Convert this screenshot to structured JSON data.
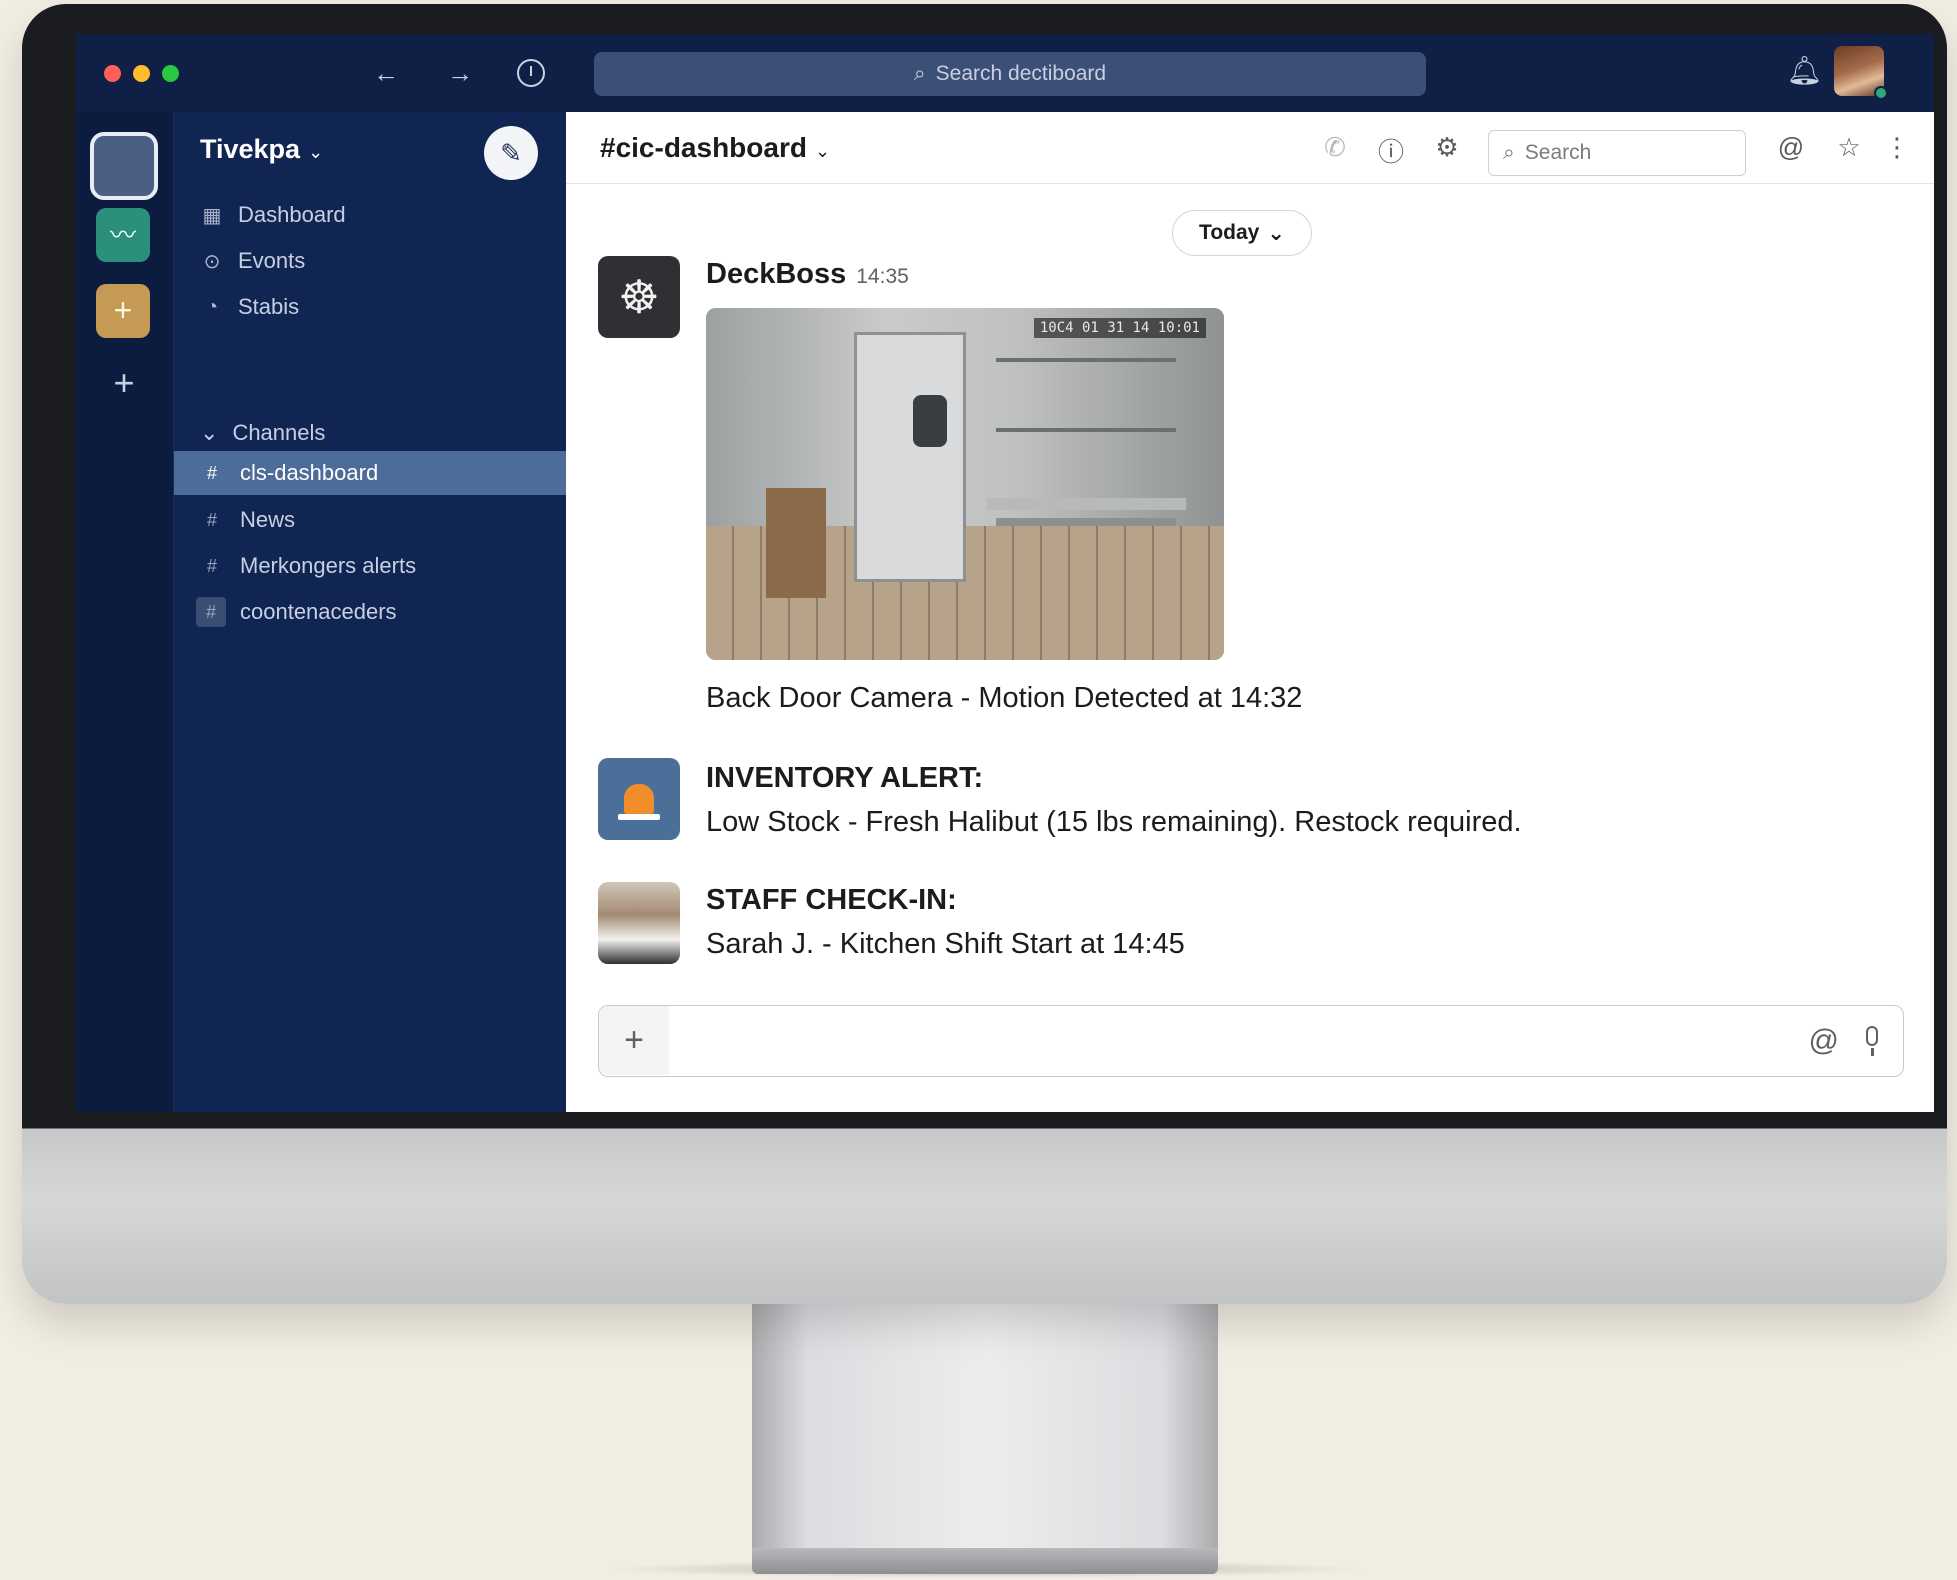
{
  "titlebar": {
    "search_placeholder": "Search dectiboard",
    "icons": [
      "back-arrow-icon",
      "forward-arrow-icon",
      "history-icon",
      "bell-icon"
    ]
  },
  "rail": {
    "workspaces": [
      "active-workspace",
      "chart-workspace",
      "plus-workspace"
    ]
  },
  "sidebar": {
    "workspace_name": "Tivekpa",
    "nav": [
      {
        "label": "Dashboard",
        "icon": "dashboard-icon"
      },
      {
        "label": "Evonts",
        "icon": "events-icon"
      },
      {
        "label": "Stabis",
        "icon": "stats-icon"
      }
    ],
    "channels_header": "Channels",
    "channels": [
      {
        "label": "cls-dashboard",
        "active": true
      },
      {
        "label": "News",
        "active": false
      },
      {
        "label": "Merkongers alerts",
        "active": false
      },
      {
        "label": "coontenaceders",
        "active": false
      }
    ]
  },
  "header": {
    "channel_title": "#cic-dashboard",
    "search_placeholder": "Search",
    "icons": [
      "phone-icon",
      "info-icon",
      "settings-icon",
      "search-icon",
      "mention-icon",
      "star-icon",
      "more-icon"
    ]
  },
  "feed": {
    "date_divider": "Today",
    "messages": [
      {
        "author": "DeckBoss",
        "time": "14:35",
        "image_timestamp": "10C4 01 31 14 10:01",
        "text": "Back Door Camera - Motion Detected at 14:32"
      },
      {
        "heading": "INVENTORY ALERT:",
        "text": "Low Stock - Fresh Halibut (15 lbs remaining). Restock required."
      },
      {
        "heading": "STAFF CHECK-IN:",
        "text": "Sarah J. - Kitchen Shift Start at 14:45"
      }
    ]
  },
  "composer": {
    "icons": [
      "plus-icon",
      "mention-icon",
      "microphone-icon"
    ]
  },
  "colors": {
    "sidebar_bg": "#112553",
    "titlebar_bg": "#0f1f45",
    "active_channel": "#4d6c9a",
    "accent_green": "#2b8f7c",
    "accent_gold": "#c49a55"
  }
}
